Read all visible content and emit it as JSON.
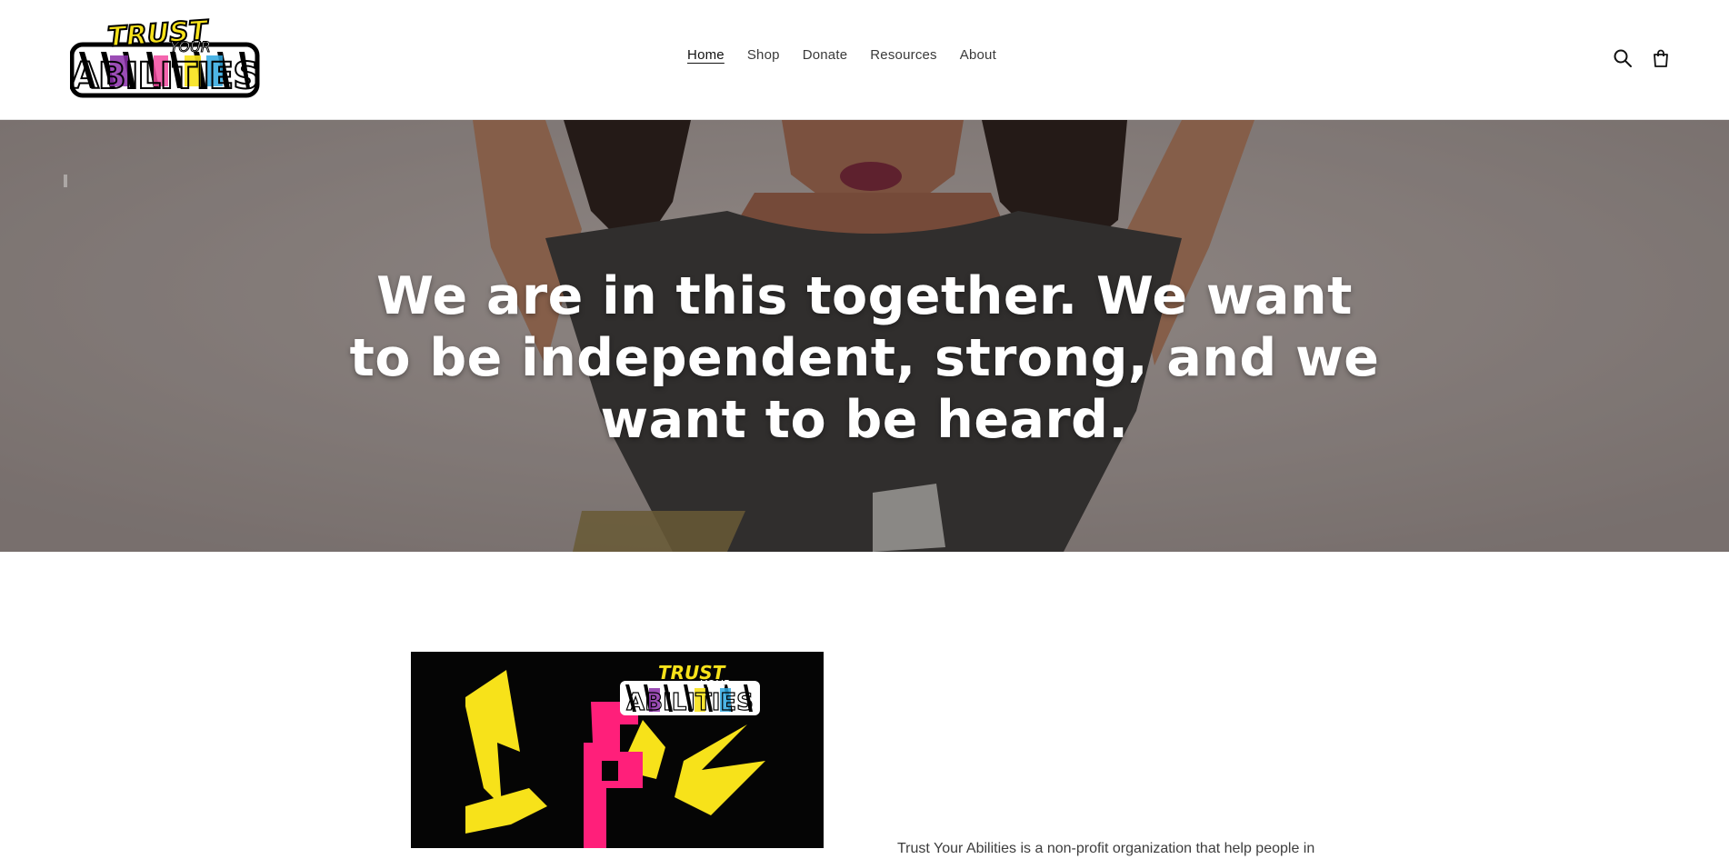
{
  "brand": {
    "logo_top": "TRUST",
    "logo_mid": "YOUR",
    "logo_bottom": "ABILITIES"
  },
  "nav": {
    "items": [
      {
        "label": "Home",
        "active": true
      },
      {
        "label": "Shop",
        "active": false
      },
      {
        "label": "Donate",
        "active": false
      },
      {
        "label": "Resources",
        "active": false
      },
      {
        "label": "About",
        "active": false
      }
    ]
  },
  "header_icons": {
    "search": "search-icon",
    "cart": "cart-icon"
  },
  "hero": {
    "heading": "We are in this together. We want to be independent, strong, and we want to be heard."
  },
  "intro": {
    "text": "Trust Your Abilities is a non-profit organization that help people in"
  },
  "colors": {
    "text": "#121212",
    "accent_yellow": "#f7e21a",
    "accent_pink": "#ff1f7a",
    "hero_shirt": "#3b3837"
  }
}
